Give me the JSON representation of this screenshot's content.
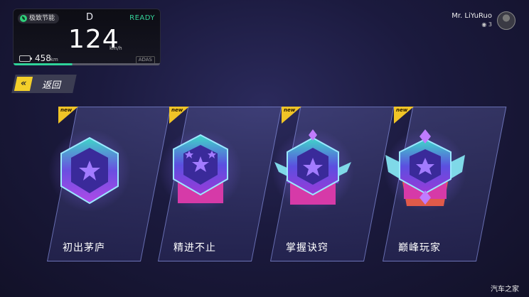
{
  "status": {
    "drive_mode": "极致节能",
    "gear": "D",
    "ready": "READY",
    "speed": "124",
    "speed_unit": "km/h",
    "range": "458",
    "range_unit": "km",
    "adas": "ADAS"
  },
  "user": {
    "name": "Mr. LiYuRuo",
    "points": "3"
  },
  "back": {
    "chevron": "«",
    "label": "返回"
  },
  "new_tag": "new",
  "cards": [
    {
      "title": "初出茅庐",
      "icon": "rank-badge-1-icon"
    },
    {
      "title": "精进不止",
      "icon": "rank-badge-2-icon"
    },
    {
      "title": "掌握诀窍",
      "icon": "rank-badge-3-icon"
    },
    {
      "title": "巅峰玩家",
      "icon": "rank-badge-4-icon"
    }
  ],
  "watermark": "汽车之家",
  "colors": {
    "accent_yellow": "#f0c427",
    "ready_green": "#35d49a",
    "badge_purple": "#7b4de0"
  }
}
